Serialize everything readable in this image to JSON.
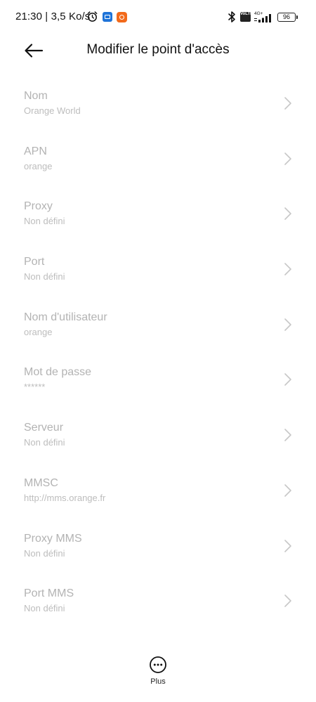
{
  "status_bar": {
    "time_speed": "21:30 | 3,5 Ko/s",
    "volte_label": "VoLTE",
    "network_label": "4G+",
    "battery": "96",
    "icons": [
      "alarm-icon",
      "app-notification-icon",
      "app-notification-icon",
      "bluetooth-icon",
      "volte-icon",
      "signal-icon",
      "battery-icon"
    ]
  },
  "header": {
    "title": "Modifier le point d'accès",
    "back_icon": "arrow-left-icon"
  },
  "fields": [
    {
      "label": "Nom",
      "value": "Orange World"
    },
    {
      "label": "APN",
      "value": "orange"
    },
    {
      "label": "Proxy",
      "value": "Non défini"
    },
    {
      "label": "Port",
      "value": "Non défini"
    },
    {
      "label": "Nom d'utilisateur",
      "value": "orange"
    },
    {
      "label": "Mot de passe",
      "value": "******"
    },
    {
      "label": "Serveur",
      "value": "Non défini"
    },
    {
      "label": "MMSC",
      "value": "http://mms.orange.fr"
    },
    {
      "label": "Proxy MMS",
      "value": "Non défini"
    },
    {
      "label": "Port MMS",
      "value": "Non défini"
    }
  ],
  "bottom": {
    "more_label": "Plus",
    "more_icon": "more-dots-icon"
  },
  "colors": {
    "label": "#b3b3b3",
    "value": "#bdbdbd",
    "text": "#111111",
    "background": "#ffffff"
  }
}
